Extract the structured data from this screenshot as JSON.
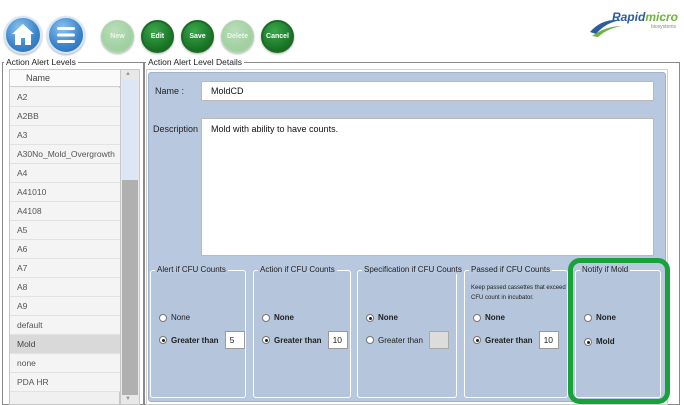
{
  "toolbar": {
    "buttons": [
      {
        "label": "New",
        "enabled": false
      },
      {
        "label": "Edit",
        "enabled": true
      },
      {
        "label": "Save",
        "enabled": true
      },
      {
        "label": "Delete",
        "enabled": false
      },
      {
        "label": "Cancel",
        "enabled": true
      }
    ],
    "logo_brand_a": "Rapid",
    "logo_brand_b": "micro",
    "logo_sub": "biosystems"
  },
  "list_group": {
    "title": "Action Alert Levels",
    "header": "Name",
    "items": [
      "A2",
      "A2BB",
      "A3",
      "A30No_Mold_Overgrowth",
      "A4",
      "A41010",
      "A4108",
      "A5",
      "A6",
      "A7",
      "A8",
      "A9",
      "default",
      "Mold",
      "none",
      "PDA HR"
    ],
    "selected": "Mold"
  },
  "details": {
    "title": "Action Alert Level Details",
    "name_label": "Name :",
    "name_value": "MoldCD",
    "description_label": "Description :",
    "description_value": "Mold with ability to have counts."
  },
  "cfu": {
    "alert": {
      "title": "Alert if CFU Counts",
      "none": "None",
      "greater": "Greater than",
      "value": "5"
    },
    "action": {
      "title": "Action if CFU Counts",
      "none": "None",
      "greater": "Greater than",
      "value": "10"
    },
    "spec": {
      "title": "Specification if CFU Counts",
      "none": "None",
      "greater": "Greater than",
      "value": ""
    },
    "passed": {
      "title": "Passed if CFU Counts",
      "note": "Keep passed cassettes that exceed CFU count in incubator.",
      "none": "None",
      "greater": "Greater than",
      "value": "10"
    },
    "mold": {
      "title": "Notify if Mold",
      "none": "None",
      "mold": "Mold"
    }
  },
  "colors": {
    "accent_green": "#17a23a",
    "panel_blue": "#b8c8de",
    "button_green": "#1d7a2a"
  }
}
